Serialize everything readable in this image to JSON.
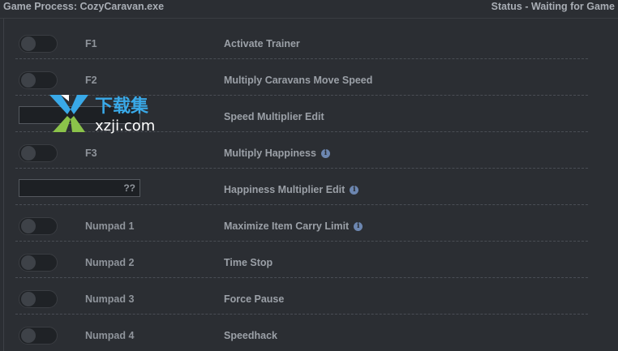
{
  "header": {
    "process_label": "Game Process: CozyCaravan.exe",
    "status_label": "Status - Waiting for Game"
  },
  "rows": [
    {
      "type": "toggle",
      "hotkey": "F1",
      "label": "Activate Trainer",
      "info": false
    },
    {
      "type": "toggle",
      "hotkey": "F2",
      "label": "Multiply Caravans Move Speed",
      "info": false
    },
    {
      "type": "edit",
      "value": "",
      "label": "Speed Multiplier Edit",
      "info": false
    },
    {
      "type": "toggle",
      "hotkey": "F3",
      "label": "Multiply Happiness",
      "info": true
    },
    {
      "type": "edit",
      "value": "??",
      "label": "Happiness Multiplier Edit",
      "info": true
    },
    {
      "type": "toggle",
      "hotkey": "Numpad 1",
      "label": "Maximize Item Carry Limit",
      "info": true
    },
    {
      "type": "toggle",
      "hotkey": "Numpad 2",
      "label": "Time Stop",
      "info": false
    },
    {
      "type": "toggle",
      "hotkey": "Numpad 3",
      "label": "Force Pause",
      "info": false
    },
    {
      "type": "toggle",
      "hotkey": "Numpad 4",
      "label": "Speedhack",
      "info": false
    }
  ],
  "watermark": {
    "cn_text": "下载集",
    "url_text": "xzji.com"
  },
  "colors": {
    "background": "#2b2e33",
    "toggle_off": "#1f2226",
    "info_icon": "#6c86b0",
    "watermark_blue": "#39a9e8"
  }
}
